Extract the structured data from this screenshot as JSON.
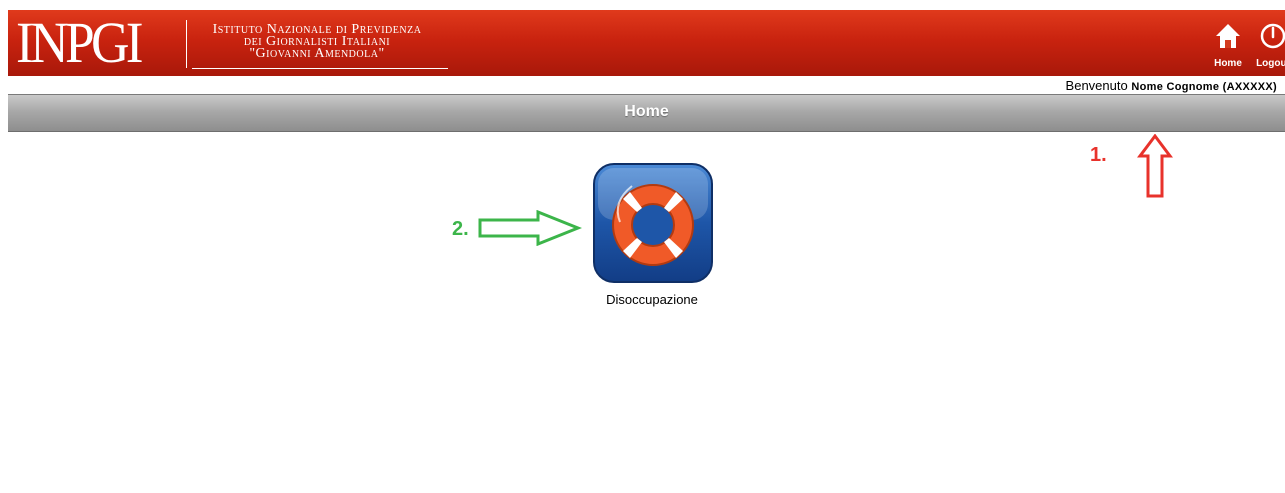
{
  "header": {
    "logo_mark": "INPGI",
    "logo_line1": "Istituto Nazionale di Previdenza",
    "logo_line2": "dei Giornalisti Italiani",
    "logo_line3": "\"Giovanni Amendola\"",
    "home_label": "Home",
    "logout_label": "Logout",
    "brand_color": "#c9230f"
  },
  "welcome": {
    "prefix": "Benvenuto",
    "user": "Nome Cognome (AXXXXX)"
  },
  "page": {
    "title": "Home"
  },
  "apps": [
    {
      "label": "Disoccupazione",
      "icon": "lifebuoy-icon"
    }
  ],
  "annotations": {
    "step1": "1.",
    "step2": "2.",
    "step1_color": "#e8322b",
    "step2_color": "#3cb54a"
  }
}
